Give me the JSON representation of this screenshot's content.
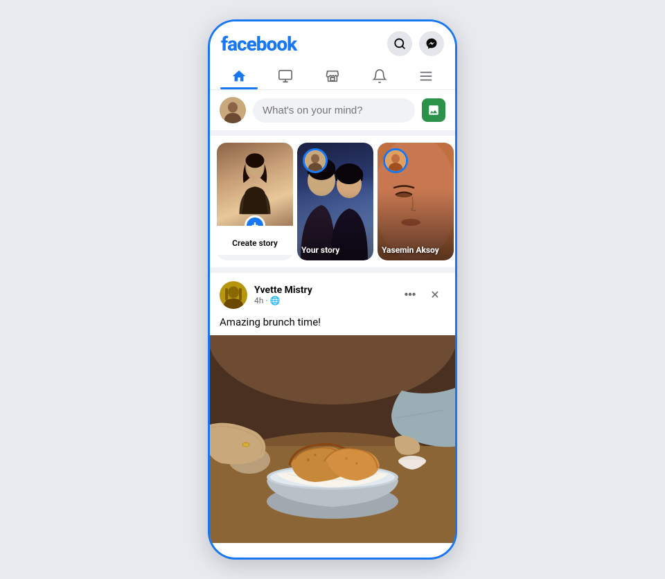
{
  "app": {
    "name": "facebook",
    "accent_color": "#1877f2"
  },
  "header": {
    "logo": "facebook",
    "search_icon": "🔍",
    "messenger_icon": "💬"
  },
  "nav": {
    "items": [
      {
        "id": "home",
        "label": "Home",
        "active": true
      },
      {
        "id": "watch",
        "label": "Watch",
        "active": false
      },
      {
        "id": "marketplace",
        "label": "Marketplace",
        "active": false
      },
      {
        "id": "notifications",
        "label": "Notifications",
        "active": false
      },
      {
        "id": "menu",
        "label": "Menu",
        "active": false
      }
    ]
  },
  "composer": {
    "placeholder": "What's on your mind?"
  },
  "stories": {
    "create_story": {
      "label": "Create story",
      "plus_icon": "+"
    },
    "items": [
      {
        "id": "your-story",
        "label": "Your story",
        "has_avatar": true,
        "avatar_ring_color": "#1877f2"
      },
      {
        "id": "yasemin",
        "label": "Yasemin Aksoy",
        "has_avatar": true,
        "avatar_ring_color": "#1877f2"
      },
      {
        "id": "partial",
        "label": "",
        "has_avatar": false
      }
    ]
  },
  "post": {
    "author": "Yvette Mistry",
    "time": "4h",
    "privacy": "🌐",
    "text": "Amazing brunch time!",
    "dots_label": "•••",
    "close_label": "✕"
  }
}
